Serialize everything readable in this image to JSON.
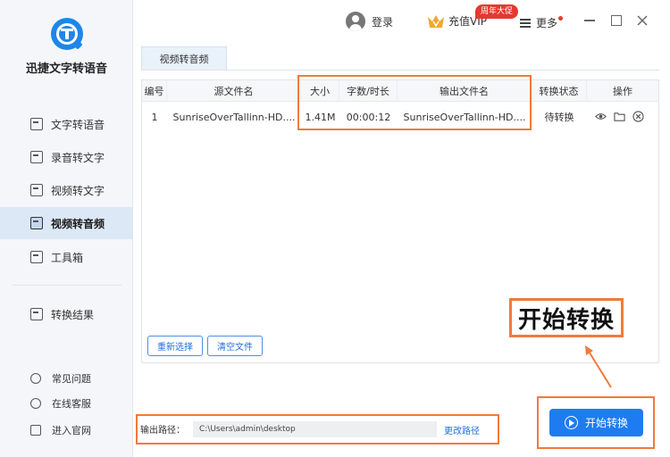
{
  "app": {
    "name": "迅捷文字转语音"
  },
  "sidebar": {
    "items": [
      {
        "label": "文字转语音",
        "icon": "text-doc-icon"
      },
      {
        "label": "录音转文字",
        "icon": "recording-icon"
      },
      {
        "label": "视频转文字",
        "icon": "video-text-icon"
      },
      {
        "label": "视频转音频",
        "icon": "video-audio-icon",
        "active": true
      },
      {
        "label": "工具箱",
        "icon": "toolbox-icon"
      },
      {
        "label": "转换结果",
        "icon": "result-icon"
      }
    ],
    "bottom": [
      {
        "label": "常见问题",
        "icon": "help-icon"
      },
      {
        "label": "在线客服",
        "icon": "headset-icon"
      },
      {
        "label": "进入官网",
        "icon": "monitor-icon"
      }
    ]
  },
  "topbar": {
    "login": "登录",
    "vip": "充值VIP",
    "promo": "周年大促",
    "more": "更多"
  },
  "tab": {
    "label": "视频转音频"
  },
  "table": {
    "headers": [
      "编号",
      "源文件名",
      "大小",
      "字数/时长",
      "输出文件名",
      "转换状态",
      "操作"
    ],
    "rows": [
      [
        "1",
        "SunriseOverTallinn-HD....",
        "1.41M",
        "00:00:12",
        "SunriseOverTallinn-HD....",
        "待转换"
      ]
    ]
  },
  "buttons": {
    "reselect": "重新选择",
    "clear": "清空文件",
    "start": "开始转换"
  },
  "output": {
    "label": "输出路径：",
    "path": "C:\\Users\\admin\\desktop",
    "change": "更改路径"
  },
  "annotation": {
    "callout": "开始转换"
  },
  "colors": {
    "accent": "#1f7cf0",
    "annotation": "#f07a3c",
    "promo": "#e23a2e"
  }
}
